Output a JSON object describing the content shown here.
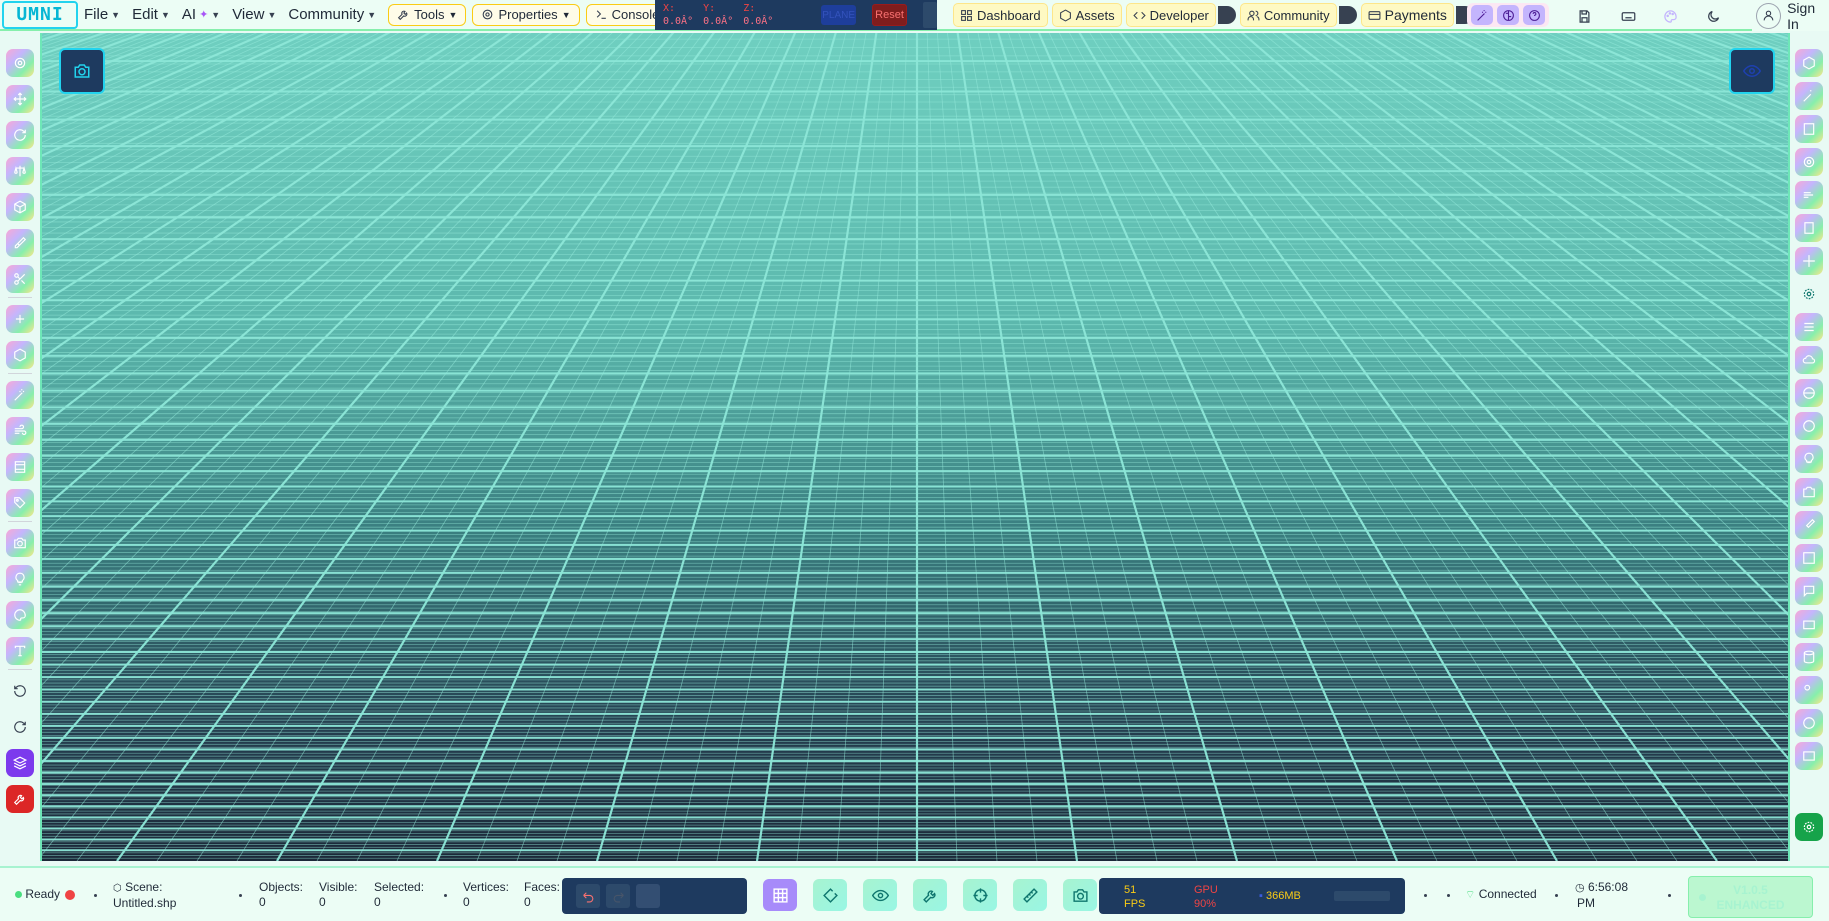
{
  "app": {
    "logo_text": "UMNI"
  },
  "menu": {
    "file": "File",
    "edit": "Edit",
    "ai": "AI",
    "view": "View",
    "community": "Community",
    "tools": "Tools",
    "properties": "Properties",
    "console": "Console"
  },
  "coords": {
    "x_label": "X:",
    "x_value": "0.0Â°",
    "y_label": "Y:",
    "y_value": "0.0Â°",
    "z_label": "Z:",
    "z_value": "0.0Â°",
    "plane_label": "PLANE",
    "reset_label": "Reset"
  },
  "nav": {
    "dashboard": "Dashboard",
    "assets": "Assets",
    "developer": "Developer",
    "community": "Community",
    "payments": "Payments"
  },
  "account": {
    "sign_in": "Sign In"
  },
  "status": {
    "ready": "Ready",
    "scene_label": "Scene:",
    "scene_file": "Untitled.shp",
    "objects_label": "Objects:",
    "objects_value": "0",
    "visible_label": "Visible:",
    "visible_value": "0",
    "selected_label": "Selected:",
    "selected_value": "0",
    "vertices_label": "Vertices:",
    "vertices_value": "0",
    "faces_label": "Faces:",
    "faces_value": "0",
    "connection": "Connected",
    "time": "6:56:08",
    "time_suffix": "PM"
  },
  "perf": {
    "fps_value": "51",
    "fps_label": "FPS",
    "gpu_label": "GPU",
    "gpu_value": "90%",
    "memory": "366MB"
  },
  "version": {
    "line1": "V1.0.5",
    "line2": "ENHANCED"
  },
  "colors": {
    "accent": "#22d3ee",
    "ready_dot": "#ef4444",
    "status_ok": "#4ade80",
    "perf_text": "#facc15",
    "gpu_text": "#ef4444"
  }
}
